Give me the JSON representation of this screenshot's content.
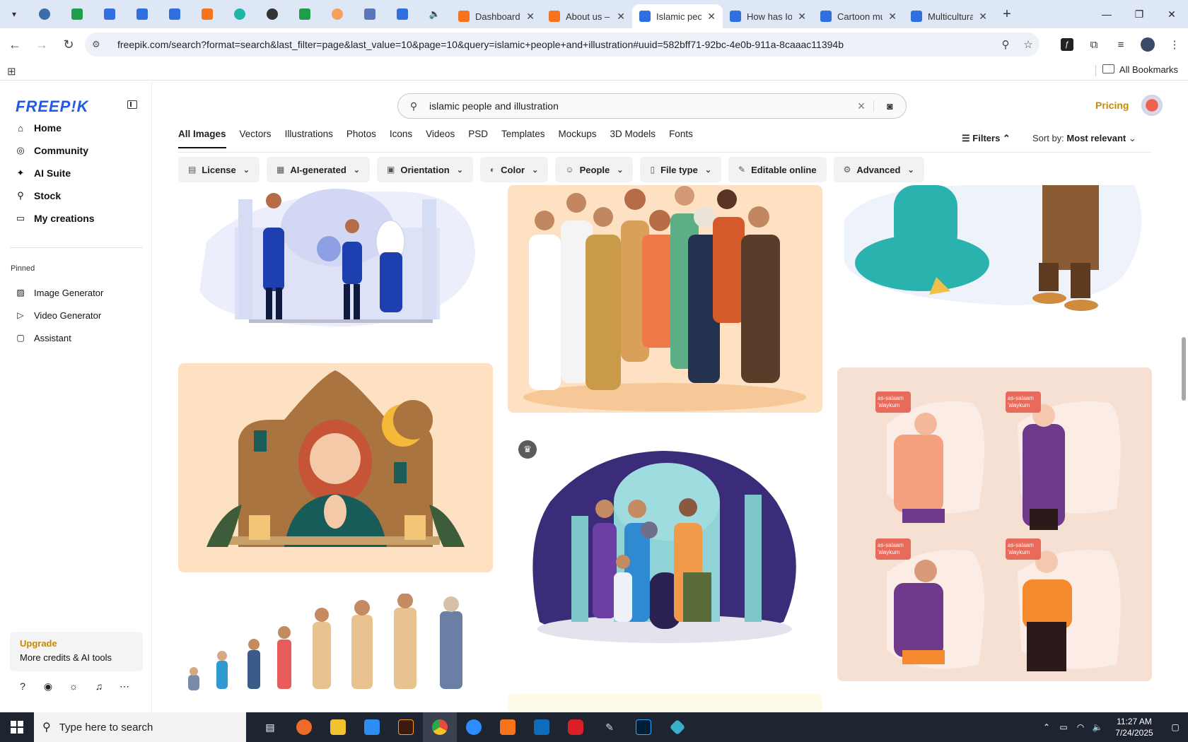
{
  "browser": {
    "tabs": [
      {
        "title": "Dashboard",
        "icon": "xampp-icon",
        "color": "#f6731c"
      },
      {
        "title": "About us – c",
        "icon": "xampp-icon",
        "color": "#f6731c"
      },
      {
        "title": "Islamic peop",
        "icon": "docs-icon",
        "color": "#2f6fe0",
        "active": true
      },
      {
        "title": "How has IoT",
        "icon": "docs-icon",
        "color": "#2f6fe0"
      },
      {
        "title": "Cartoon mu",
        "icon": "docs-icon",
        "color": "#2f6fe0"
      },
      {
        "title": "Multicultura",
        "icon": "docs-icon",
        "color": "#2f6fe0"
      }
    ],
    "url": "freepik.com/search?format=search&last_filter=page&last_value=10&page=10&query=islamic+people+and+illustration#uuid=582bff71-92bc-4e0b-911a-8caaac11394b",
    "bookmarks_label": "All Bookmarks"
  },
  "sidebar": {
    "logo": "FREEP!K",
    "nav": [
      {
        "label": "Home",
        "icon": "home-icon",
        "glyph": "⌂"
      },
      {
        "label": "Community",
        "icon": "globe-icon",
        "glyph": "◎"
      },
      {
        "label": "AI Suite",
        "icon": "sparkle-icon",
        "glyph": "✦"
      },
      {
        "label": "Stock",
        "icon": "search-icon",
        "glyph": "⚲"
      },
      {
        "label": "My creations",
        "icon": "folder-icon",
        "glyph": "▭"
      }
    ],
    "pinned_heading": "Pinned",
    "pinned": [
      {
        "label": "Image Generator",
        "icon": "image-icon",
        "glyph": "▨"
      },
      {
        "label": "Video Generator",
        "icon": "video-icon",
        "glyph": "▷"
      },
      {
        "label": "Assistant",
        "icon": "chat-icon",
        "glyph": "▢"
      }
    ],
    "upgrade_title": "Upgrade",
    "upgrade_sub": "More credits & AI tools"
  },
  "header": {
    "search_query": "islamic people and illustration",
    "pricing": "Pricing"
  },
  "type_tabs": [
    "All Images",
    "Vectors",
    "Illustrations",
    "Photos",
    "Icons",
    "Videos",
    "PSD",
    "Templates",
    "Mockups",
    "3D Models",
    "Fonts"
  ],
  "filters_label": "Filters",
  "sort": {
    "label": "Sort by:",
    "value": "Most relevant"
  },
  "chips": [
    {
      "label": "License",
      "icon": "license-icon",
      "glyph": "▤"
    },
    {
      "label": "AI-generated",
      "icon": "ai-icon",
      "glyph": "▦"
    },
    {
      "label": "Orientation",
      "icon": "orientation-icon",
      "glyph": "▣"
    },
    {
      "label": "Color",
      "icon": "palette-icon",
      "glyph": "◐"
    },
    {
      "label": "People",
      "icon": "people-icon",
      "glyph": "☺"
    },
    {
      "label": "File type",
      "icon": "file-icon",
      "glyph": "▯"
    },
    {
      "label": "Editable online",
      "icon": "pen-icon",
      "glyph": "✎",
      "no_caret": true
    },
    {
      "label": "Advanced",
      "icon": "gear-icon",
      "glyph": "⚙"
    }
  ],
  "speech_bubble_text": "as-salaam 'alaykum",
  "taskbar": {
    "search_placeholder": "Type here to search",
    "time": "11:27 AM",
    "date": "7/24/2025"
  }
}
